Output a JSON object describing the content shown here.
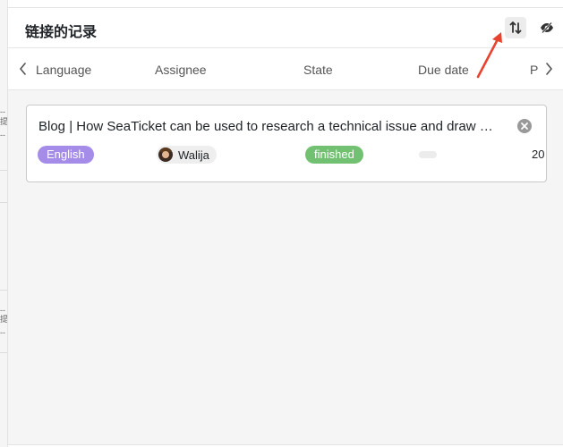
{
  "dialog": {
    "title": "链接的记录",
    "toolbar": {
      "sort_icon": "sort-icon",
      "hide_icon": "eye-slash-icon"
    }
  },
  "columns": {
    "headers": [
      "Language",
      "Assignee",
      "State",
      "Due date"
    ],
    "partial_header": "P",
    "prev_icon": "chevron-left-icon",
    "next_icon": "chevron-right-icon"
  },
  "record": {
    "title": "Blog | How SeaTicket can be used to research a technical issue and draw …",
    "language": "English",
    "assignee": "Walija",
    "state": "finished",
    "due_date": "",
    "partial_value": "20",
    "remove_icon": "close-circle-icon"
  },
  "background": {
    "marks": [
      "--",
      "提",
      "--",
      "--",
      "提",
      "--"
    ]
  },
  "colors": {
    "language_tag": "#a58ce8",
    "state_tag": "#72c173",
    "annotation_arrow": "#e8432f"
  }
}
